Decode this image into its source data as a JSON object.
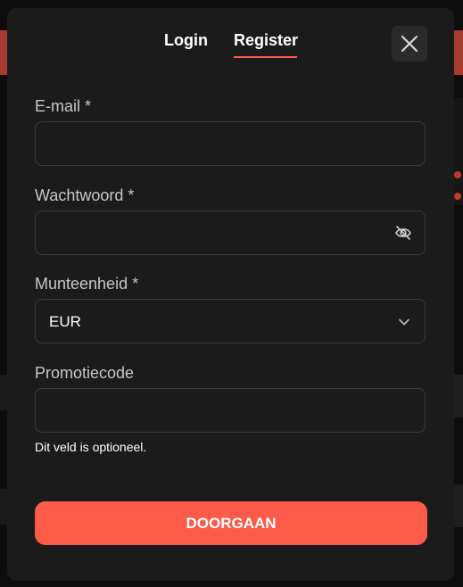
{
  "tabs": {
    "login": "Login",
    "register": "Register",
    "active": "register"
  },
  "fields": {
    "email": {
      "label": "E-mail *",
      "value": "",
      "placeholder": ""
    },
    "password": {
      "label": "Wachtwoord *",
      "value": "",
      "placeholder": ""
    },
    "currency": {
      "label": "Munteenheid *",
      "value": "EUR"
    },
    "promo": {
      "label": "Promotiecode",
      "value": "",
      "placeholder": "",
      "hint": "Dit veld is optioneel."
    }
  },
  "submit_label": "DOORGAAN",
  "colors": {
    "accent": "#ff5b4a",
    "modal_bg": "#1b1b1b",
    "field_border": "#3c3c3c"
  },
  "icons": {
    "close": "close-icon",
    "visibility": "eye-off-icon",
    "dropdown": "chevron-down-icon"
  }
}
